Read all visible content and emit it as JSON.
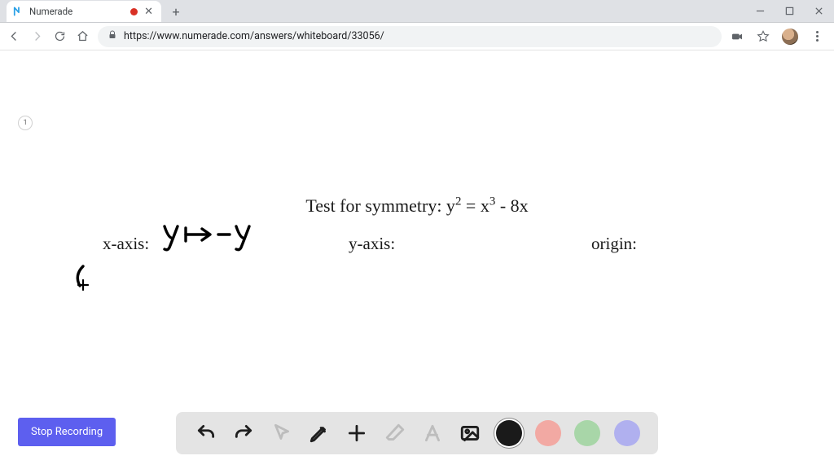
{
  "browser": {
    "tab_title": "Numerade",
    "url": "https://www.numerade.com/answers/whiteboard/33056/"
  },
  "whiteboard": {
    "page_number": "1",
    "equation_prefix": "Test for symmetry: y",
    "equation_exp1": "2",
    "equation_mid": " = x",
    "equation_exp2": "3",
    "equation_suffix": " - 8x",
    "xaxis_label": "x-axis:",
    "yaxis_label": "y-axis:",
    "origin_label": "origin:",
    "handwriting_xaxis": "y ↦ -y",
    "handwriting_fragment": "("
  },
  "controls": {
    "stop_label": "Stop Recording"
  },
  "toolbar": {
    "undo": "undo",
    "redo": "redo",
    "pointer": "pointer",
    "pen": "pen",
    "plus": "add",
    "eraser": "eraser",
    "text": "text",
    "image": "image",
    "color_black": "#1a1a1a",
    "color_red": "#f2a9a3",
    "color_green": "#a8d6a8",
    "color_purple": "#b0b0ef",
    "selected_tool": "pen",
    "selected_color": "black"
  }
}
